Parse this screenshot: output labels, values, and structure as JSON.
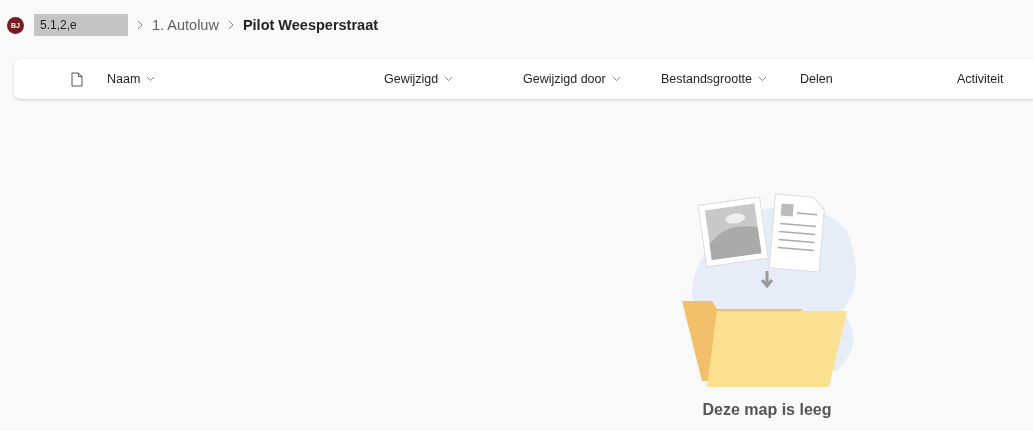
{
  "breadcrumb": {
    "avatar": "BJ",
    "items": [
      {
        "label": "5.1,2,e",
        "kind": "redacted"
      },
      {
        "label": "1. Autoluw",
        "kind": "link",
        "current": false
      },
      {
        "label": "Pilot Weesperstraat",
        "kind": "link",
        "current": true
      }
    ]
  },
  "table": {
    "columns": [
      {
        "label": "Naam",
        "sortable": true
      },
      {
        "label": "Gewijzigd",
        "sortable": true
      },
      {
        "label": "Gewijzigd door",
        "sortable": true
      },
      {
        "label": "Bestandsgrootte",
        "sortable": true
      },
      {
        "label": "Delen",
        "sortable": false
      },
      {
        "label": "Activiteit",
        "sortable": false
      }
    ]
  },
  "empty_state": {
    "message": "Deze map is leeg"
  }
}
